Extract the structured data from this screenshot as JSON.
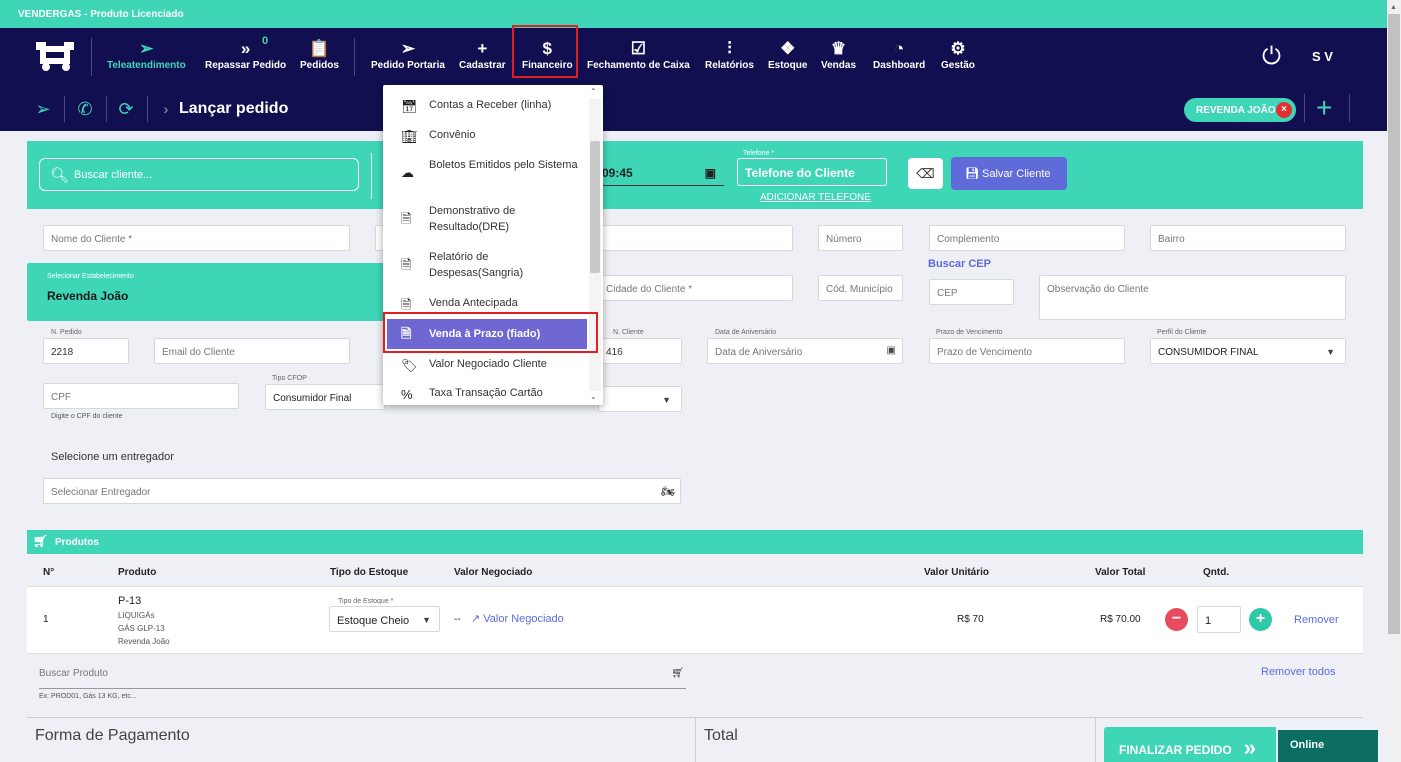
{
  "window": {
    "title": "VENDERGAS - Produto Licenciado"
  },
  "nav": {
    "items": [
      {
        "label": "Teleatendimento",
        "icon": "send-icon"
      },
      {
        "label": "Repassar Pedido",
        "icon": "double-chevron-icon",
        "badge": "0"
      },
      {
        "label": "Pedidos",
        "icon": "clipboard-icon"
      },
      {
        "label": "Pedido Portaria",
        "icon": "send-icon"
      },
      {
        "label": "Cadastrar",
        "icon": "plus-icon"
      },
      {
        "label": "Financeiro",
        "icon": "dollar-icon"
      },
      {
        "label": "Fechamento de Caixa",
        "icon": "check-square-icon"
      },
      {
        "label": "Relatórios",
        "icon": "sliders-icon"
      },
      {
        "label": "Estoque",
        "icon": "dropbox-icon"
      },
      {
        "label": "Vendas",
        "icon": "basket-icon"
      },
      {
        "label": "Dashboard",
        "icon": "pie-chart-icon"
      },
      {
        "label": "Gestão",
        "icon": "gears-icon"
      }
    ],
    "user_initials": "S V"
  },
  "subheader": {
    "title": "Lançar pedido",
    "revenda_chip": "REVENDA JOÃO"
  },
  "client_bar": {
    "search_placeholder": "Buscar cliente...",
    "time": "09:45",
    "phone_label": "Telefone *",
    "phone_placeholder": "Telefone do Cliente",
    "add_phone": "ADICIONAR TELEFONE",
    "save_button": "Salvar Cliente"
  },
  "form": {
    "nome": "Nome do Cliente *",
    "numero": "Número",
    "complemento": "Complemento",
    "bairro": "Bairro",
    "estab_label": "Selecionar Estabelecimento",
    "estab_value": "Revenda João",
    "cidade": "Cidade do Cliente *",
    "cod_municipio": "Cód. Município",
    "buscar_cep": "Buscar CEP",
    "cep": "CEP",
    "observacao": "Observação do Cliente",
    "n_pedido_label": "N. Pedido",
    "n_pedido": "2218",
    "email": "Email do Cliente",
    "n_cliente_label": "N. Cliente",
    "n_cliente": "416",
    "aniversario_label": "Data de Aniversário",
    "aniversario": "Data de Aniversário",
    "prazo_label": "Prazo de Vencimento",
    "prazo": "Prazo de Vencimento",
    "perfil_label": "Perfil do Cliente",
    "perfil": "CONSUMIDOR FINAL",
    "cpf": "CPF",
    "cpf_hint": "Digite o CPF do cliente",
    "cfop_label": "Tipo CFOP",
    "cfop": "Consumidor Final",
    "entregador_title": "Selecione um entregador",
    "entregador": "Selecionar Entregador"
  },
  "products": {
    "header": "Produtos",
    "columns": [
      "N°",
      "Produto",
      "Tipo do Estoque",
      "Valor Negociado",
      "Valor Unitário",
      "Valor Total",
      "Qntd."
    ],
    "row": {
      "n": "1",
      "produto": "P-13",
      "marca": "LIQUIGÁs",
      "tipo": "GÁS GLP-13",
      "revenda": "Revenda João",
      "estoque_label": "Tipo de Estoque *",
      "estoque": "Estoque Cheio",
      "dash": "--",
      "valor_negociado": "Valor Negociado",
      "valor_unitario": "R$ 70",
      "valor_total": "R$ 70.00",
      "qntd": "1",
      "remover": "Remover"
    },
    "buscar_placeholder": "Buscar Produto",
    "buscar_hint": "Ex: PROD01, Gás 13 KG, etc...",
    "remover_todos": "Remover todos"
  },
  "bottom": {
    "forma_pagamento": "Forma de Pagamento",
    "total": "Total",
    "finalizar": "FINALIZAR PEDIDO",
    "online": "Online"
  },
  "dropdown": {
    "items": [
      {
        "label": "Contas a Receber (linha)",
        "icon": "calendar-check-icon"
      },
      {
        "label": "Convênio",
        "icon": "building-icon"
      },
      {
        "label": "Boletos Emitidos pelo Sistema",
        "icon": "cloud-download-icon"
      },
      {
        "label": "Demonstrativo de Resultado(DRE)",
        "icon": "document-icon"
      },
      {
        "label": "Relatório de Despesas(Sangria)",
        "icon": "document-icon"
      },
      {
        "label": "Venda Antecipada",
        "icon": "document-icon"
      },
      {
        "label": "Venda à Prazo (fiado)",
        "icon": "document-icon"
      },
      {
        "label": "Valor Negociado Cliente",
        "icon": "tags-icon"
      },
      {
        "label": "Taxa Transação Cartão",
        "icon": "percent-icon"
      }
    ]
  },
  "colors": {
    "teal": "#3fd6b8",
    "navy": "#120f50",
    "purple": "#6f68d2",
    "highlight_red": "#e02020"
  }
}
